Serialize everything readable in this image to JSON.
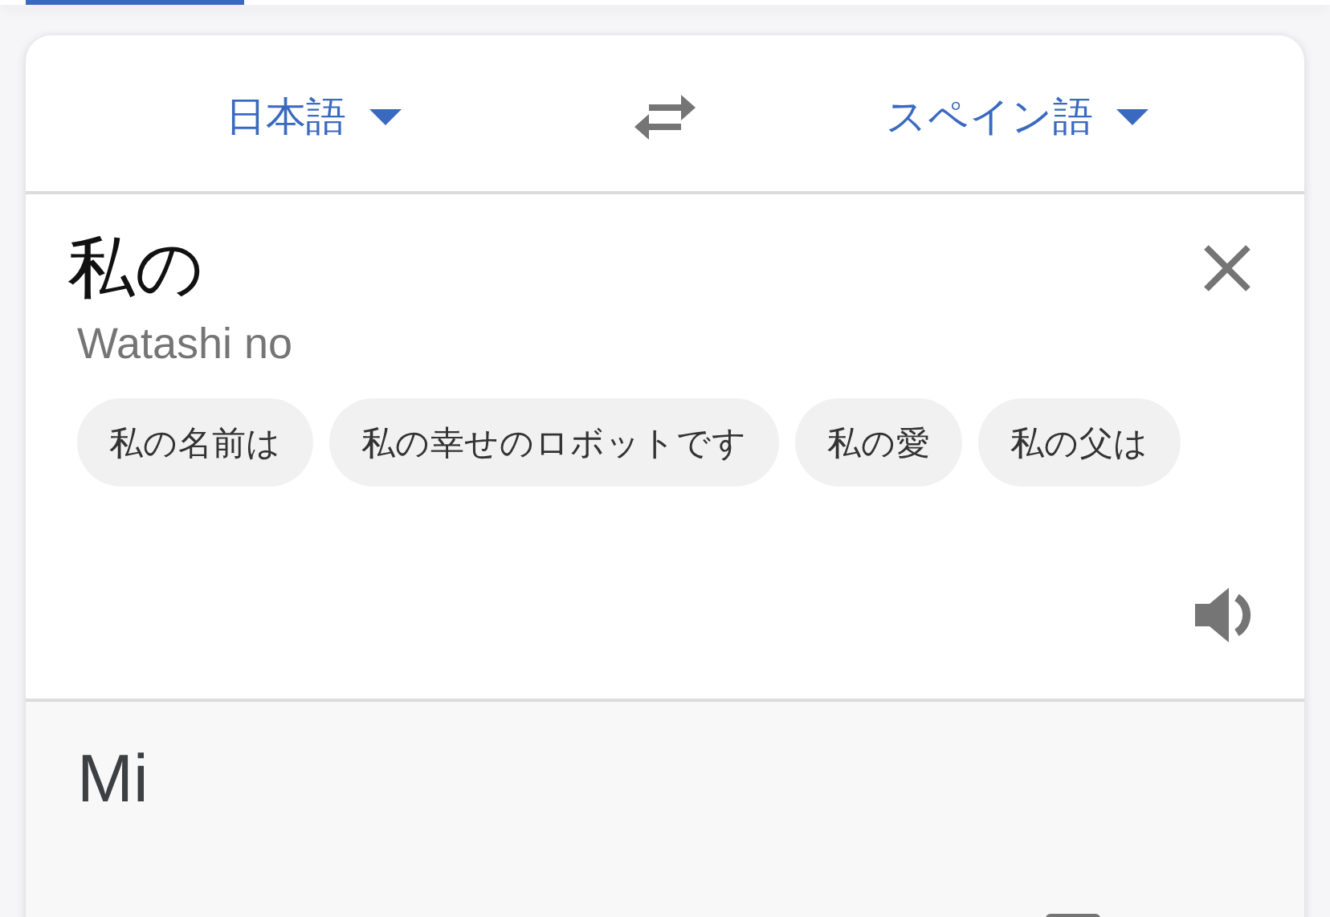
{
  "languages": {
    "source": "日本語",
    "target": "スペイン語"
  },
  "input": {
    "text": "私の",
    "romanization": "Watashi no"
  },
  "suggestions": [
    "私の名前は",
    "私の幸せのロボットです",
    "私の愛",
    "私の父は"
  ],
  "output": {
    "text": "Mi"
  }
}
